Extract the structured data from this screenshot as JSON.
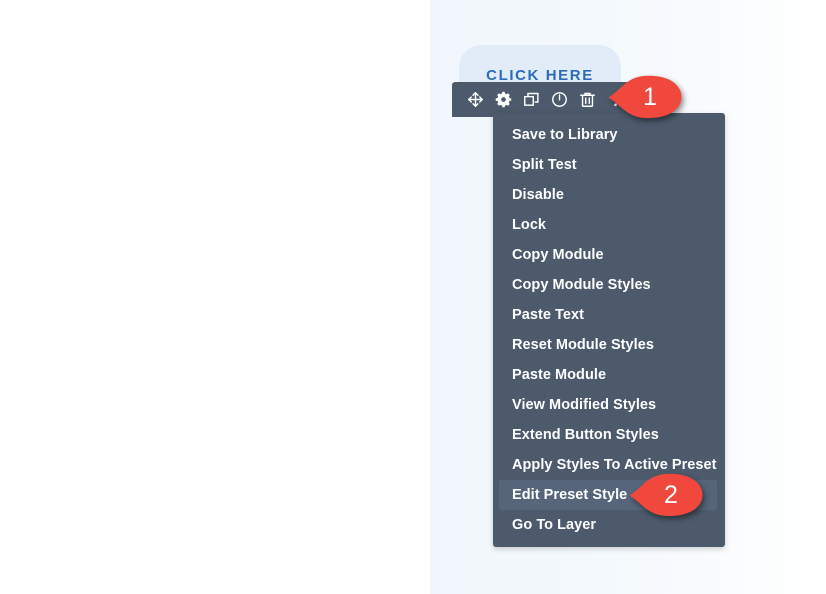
{
  "page": {
    "background_color": "#ffffff",
    "section_background_color": "#eef5fb"
  },
  "module": {
    "name": "button-module",
    "label": "CLICK HERE",
    "text_color": "#2b6cb8",
    "background_color": "#e2ecf8"
  },
  "toolbar": {
    "background_color": "#4c5a6b",
    "buttons": [
      {
        "name": "move-icon",
        "tooltip": "Move Module"
      },
      {
        "name": "gear-icon",
        "tooltip": "Module Settings"
      },
      {
        "name": "duplicate-icon",
        "tooltip": "Duplicate Module"
      },
      {
        "name": "power-icon",
        "tooltip": "Disable Module"
      },
      {
        "name": "trash-icon",
        "tooltip": "Delete Module"
      },
      {
        "name": "more-options-icon",
        "tooltip": "Other Options"
      }
    ]
  },
  "menu": {
    "background_color": "#4c5a6b",
    "selected_background_color": "#56657a",
    "selected_index": 11,
    "items": [
      {
        "label": "Save to Library"
      },
      {
        "label": "Split Test"
      },
      {
        "label": "Disable"
      },
      {
        "label": "Lock"
      },
      {
        "label": "Copy Module"
      },
      {
        "label": "Copy Module Styles"
      },
      {
        "label": "Paste Text"
      },
      {
        "label": "Reset Module Styles"
      },
      {
        "label": "Paste Module"
      },
      {
        "label": "View Modified Styles"
      },
      {
        "label": "Extend Button Styles"
      },
      {
        "label": "Apply Styles To Active Preset"
      },
      {
        "label": "Edit Preset Style"
      },
      {
        "label": "Go To Layer"
      }
    ]
  },
  "markers": {
    "color": "#f0483c",
    "items": [
      {
        "number": "1",
        "points_to": "more-options-icon"
      },
      {
        "number": "2",
        "points_to": "menu-item-edit-preset-style"
      }
    ]
  }
}
